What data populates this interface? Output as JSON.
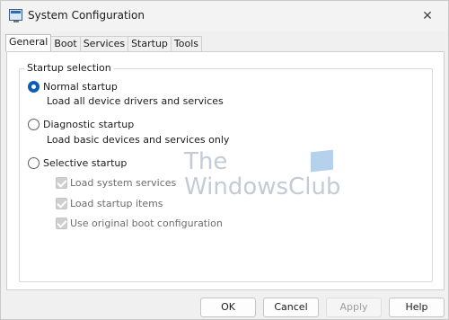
{
  "window": {
    "title": "System Configuration",
    "close_glyph": "✕"
  },
  "tabs": [
    {
      "label": "General",
      "active": true
    },
    {
      "label": "Boot",
      "active": false
    },
    {
      "label": "Services",
      "active": false
    },
    {
      "label": "Startup",
      "active": false
    },
    {
      "label": "Tools",
      "active": false
    }
  ],
  "startup_selection": {
    "legend": "Startup selection",
    "normal": {
      "label": "Normal startup",
      "description": "Load all device drivers and services",
      "checked": true
    },
    "diagnostic": {
      "label": "Diagnostic startup",
      "description": "Load basic devices and services only",
      "checked": false
    },
    "selective": {
      "label": "Selective startup",
      "checked": false
    },
    "selective_options": [
      {
        "label": "Load system services",
        "checked": true,
        "enabled": false
      },
      {
        "label": "Load startup items",
        "checked": true,
        "enabled": false
      },
      {
        "label": "Use original boot configuration",
        "checked": true,
        "enabled": false
      }
    ]
  },
  "watermark": {
    "line1": "The",
    "line2": "WindowsClub"
  },
  "buttons": {
    "ok": "OK",
    "cancel": "Cancel",
    "apply": "Apply",
    "help": "Help"
  },
  "colors": {
    "accent": "#0a5fb4",
    "disabled_text": "#6d6d6d"
  },
  "icons": {
    "app": "msconfig-window-icon",
    "close": "close-icon"
  }
}
